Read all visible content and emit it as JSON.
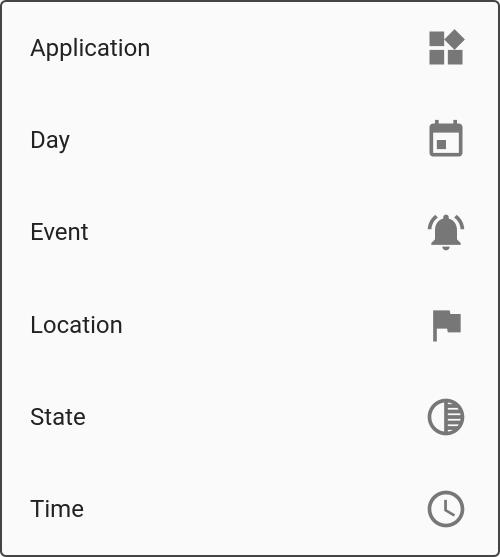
{
  "menu": {
    "items": [
      {
        "label": "Application",
        "icon": "widgets-icon"
      },
      {
        "label": "Day",
        "icon": "calendar-icon"
      },
      {
        "label": "Event",
        "icon": "alert-bell-icon"
      },
      {
        "label": "Location",
        "icon": "flag-icon"
      },
      {
        "label": "State",
        "icon": "tonality-icon"
      },
      {
        "label": "Time",
        "icon": "clock-icon"
      }
    ]
  }
}
